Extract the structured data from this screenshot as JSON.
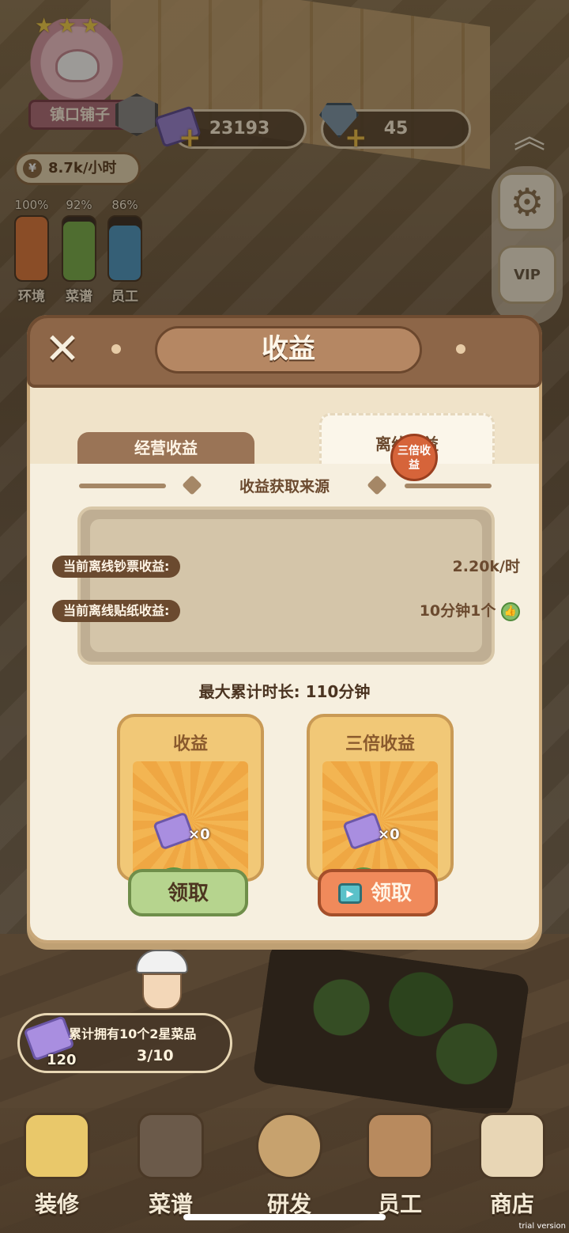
{
  "hud": {
    "shop_name": "镇口铺子",
    "stars": "★★★",
    "money": "23193",
    "gems": "45",
    "plus": "+",
    "income_rate": "8.7k/小时",
    "income_coin": "¥",
    "meters": [
      {
        "pct": "100%",
        "label": "环境",
        "value": 1.0
      },
      {
        "pct": "92%",
        "label": "菜谱",
        "value": 0.92
      },
      {
        "pct": "86%",
        "label": "员工",
        "value": 0.86
      }
    ],
    "side_icons": [
      "gear-icon",
      "vip-icon"
    ],
    "vip_label": "VIP"
  },
  "modal": {
    "title": "收益",
    "close": "✕",
    "tabs": {
      "business": "经营收益",
      "offline": "离线收益"
    },
    "section_title": "收益获取来源",
    "rows": [
      {
        "label": "当前离线钞票收益:",
        "value": "2.20k/时"
      },
      {
        "label": "当前离线贴纸收益:",
        "value": "10分钟1个"
      }
    ],
    "max_duration": "最大累计时长:  110分钟",
    "cards": [
      {
        "title": "收益",
        "bill_count": "×0",
        "sticker_count": "×0",
        "button": "领取"
      },
      {
        "title": "三倍收益",
        "bill_count": "×0",
        "sticker_count": "×0",
        "button": "领取",
        "seal": "三倍收益"
      }
    ]
  },
  "quest": {
    "text": "累计拥有10个2星菜品",
    "reward_count": "120",
    "progress": "3/10"
  },
  "nav": [
    {
      "label": "装修",
      "icon": "broom-icon"
    },
    {
      "label": "菜谱",
      "icon": "recipe-board-icon"
    },
    {
      "label": "研发",
      "icon": "cooking-pot-icon"
    },
    {
      "label": "员工",
      "icon": "staff-cards-icon"
    },
    {
      "label": "商店",
      "icon": "shopping-bag-icon"
    }
  ],
  "watermark": "trial version",
  "colors": {
    "header": "#8d6648",
    "panel": "#f6efdf",
    "green_button": "#b6d48e",
    "orange_button": "#f08a5b"
  }
}
